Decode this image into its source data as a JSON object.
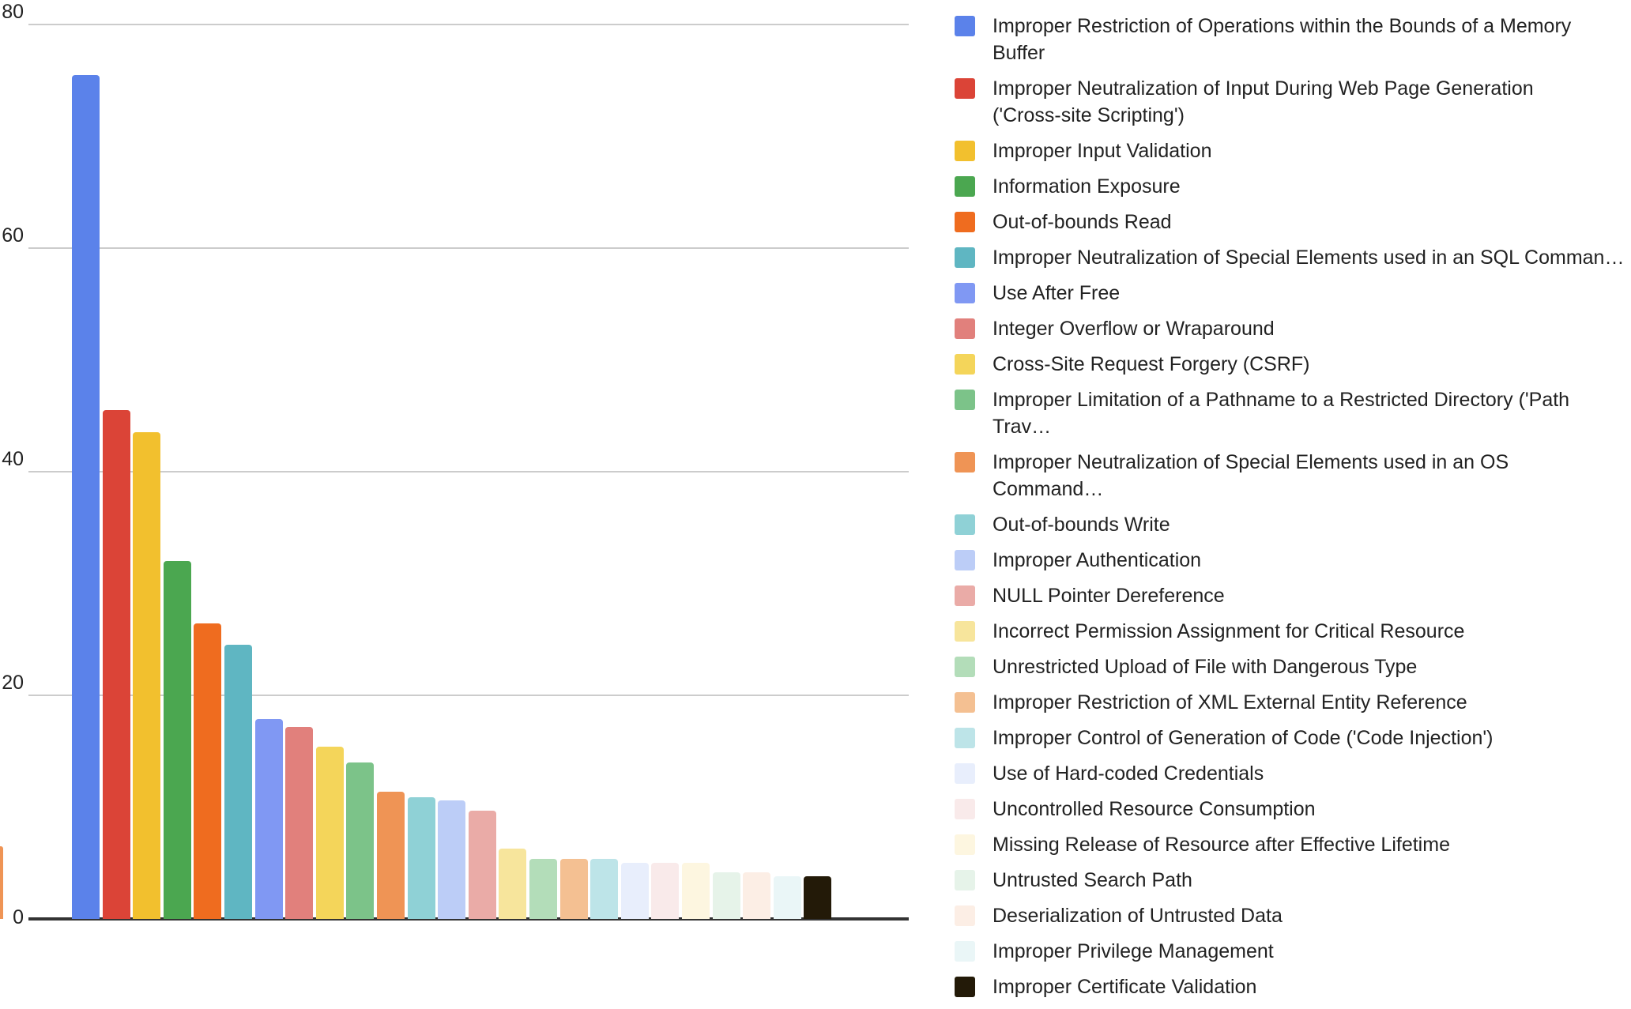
{
  "chart_data": {
    "type": "bar",
    "title": "",
    "subtitle": "",
    "xlabel": "",
    "ylabel": "",
    "ylim": [
      0,
      80
    ],
    "yticks": [
      "0",
      "20",
      "40",
      "60",
      "80"
    ],
    "grid": true,
    "legend_position": "right",
    "categories": [
      "Improper Restriction of Operations within the Bounds of a Memory Buffer",
      "Improper Neutralization of Input During Web Page Generation ('Cross-site Scripting')",
      "Improper Input Validation",
      "Information Exposure",
      "Out-of-bounds Read",
      "Improper Neutralization of Special Elements used in an SQL Command ('SQL Injection')",
      "Use After Free",
      "Integer Overflow or Wraparound",
      "Cross-Site Request Forgery (CSRF)",
      "Improper Limitation of a Pathname to a Restricted Directory ('Path Traversal')",
      "Improper Neutralization of Special Elements used in an OS Command ('OS Command Injection')",
      "Out-of-bounds Write",
      "Improper Authentication",
      "NULL Pointer Dereference",
      "Incorrect Permission Assignment for Critical Resource",
      "Unrestricted Upload of File with Dangerous Type",
      "Improper Restriction of XML External Entity Reference",
      "Improper Control of Generation of Code ('Code Injection')",
      "Use of Hard-coded Credentials",
      "Uncontrolled Resource Consumption",
      "Missing Release of Resource after Effective Lifetime",
      "Untrusted Search Path",
      "Deserialization of Untrusted Data",
      "Improper Privilege Management",
      "Improper Certificate Validation"
    ],
    "values": [
      75.5,
      45.5,
      43.5,
      32,
      26.4,
      24.5,
      17.9,
      17.2,
      15.4,
      14,
      11.4,
      10.9,
      10.6,
      9.7,
      6.3,
      5.4,
      5.4,
      5.4,
      5,
      5,
      5,
      4.2,
      4.2,
      3.8,
      3.8
    ],
    "colors": [
      "#5b82ea",
      "#db4437",
      "#f2c02e",
      "#4ba750",
      "#ef6c1f",
      "#5fb6c2",
      "#8098f3",
      "#e1807c",
      "#f4d55a",
      "#7cc389",
      "#ef9455",
      "#8fd1d6",
      "#bccdf7",
      "#eaaba7",
      "#f7e59c",
      "#b3ddb9",
      "#f4c092",
      "#bde4e8",
      "#e8eefc",
      "#f9eaea",
      "#fdf6e0",
      "#e6f3e9",
      "#fceee5",
      "#eaf6f7",
      "#231a08"
    ]
  },
  "legend": {
    "items": [
      {
        "label": "Improper Restriction of Operations within the Bounds of a Memory Buffer",
        "color": "#5b82ea"
      },
      {
        "label": "Improper Neutralization of Input During Web Page Generation\n('Cross-site Scripting')",
        "color": "#db4437"
      },
      {
        "label": "Improper Input Validation",
        "color": "#f2c02e"
      },
      {
        "label": "Information Exposure",
        "color": "#4ba750"
      },
      {
        "label": "Out-of-bounds Read",
        "color": "#ef6c1f"
      },
      {
        "label": "Improper Neutralization of Special Elements used in an SQL Comman…",
        "color": "#5fb6c2"
      },
      {
        "label": "Use After Free",
        "color": "#8098f3"
      },
      {
        "label": "Integer Overflow or Wraparound",
        "color": "#e1807c"
      },
      {
        "label": "Cross-Site Request Forgery (CSRF)",
        "color": "#f4d55a"
      },
      {
        "label": "Improper Limitation of a Pathname to a Restricted Directory ('Path Trav…",
        "color": "#7cc389"
      },
      {
        "label": "Improper Neutralization of Special Elements used in an OS Command…",
        "color": "#ef9455"
      },
      {
        "label": "Out-of-bounds Write",
        "color": "#8fd1d6"
      },
      {
        "label": "Improper Authentication",
        "color": "#bccdf7"
      },
      {
        "label": "NULL Pointer Dereference",
        "color": "#eaaba7"
      },
      {
        "label": "Incorrect Permission Assignment for Critical Resource",
        "color": "#f7e59c"
      },
      {
        "label": "Unrestricted Upload of File with Dangerous Type",
        "color": "#b3ddb9"
      },
      {
        "label": "Improper Restriction of XML External Entity Reference",
        "color": "#f4c092"
      },
      {
        "label": "Improper Control of Generation of Code ('Code Injection')",
        "color": "#bde4e8"
      },
      {
        "label": "Use of Hard-coded Credentials",
        "color": "#e8eefc"
      },
      {
        "label": "Uncontrolled Resource Consumption",
        "color": "#f9eaea"
      },
      {
        "label": "Missing Release of Resource after Effective Lifetime",
        "color": "#fdf6e0"
      },
      {
        "label": "Untrusted Search Path",
        "color": "#e6f3e9"
      },
      {
        "label": "Deserialization of Untrusted Data",
        "color": "#fceee5"
      },
      {
        "label": "Improper Privilege Management",
        "color": "#eaf6f7"
      },
      {
        "label": "Improper Certificate Validation",
        "color": "#231a08"
      }
    ]
  }
}
